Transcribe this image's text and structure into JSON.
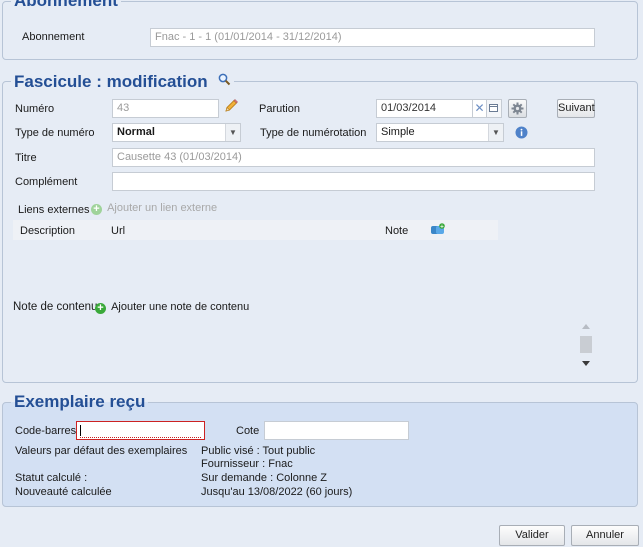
{
  "abonnement": {
    "legend": "Abonnement",
    "label": "Abonnement",
    "value": "Fnac - 1 - 1 (01/01/2014 - 31/12/2014)"
  },
  "fascicule": {
    "legend": "Fascicule : modification",
    "numero_label": "Numéro",
    "numero_value": "43",
    "parution_label": "Parution",
    "parution_value": "01/03/2014",
    "suivant_label": "Suivant",
    "type_numero_label": "Type de numéro",
    "type_numero_value": "Normal",
    "type_numerotation_label": "Type de numérotation",
    "type_numerotation_value": "Simple",
    "titre_label": "Titre",
    "titre_value": "Causette 43 (01/03/2014)",
    "complement_label": "Complément",
    "complement_value": "",
    "liens_label": "Liens externes",
    "add_lien_label": "Ajouter un lien externe",
    "table_headers": {
      "description": "Description",
      "url": "Url",
      "note": "Note"
    },
    "note_contenu_label": "Note de contenu",
    "add_note_label": "Ajouter une note de contenu"
  },
  "exemplaire": {
    "legend": "Exemplaire reçu",
    "code_barres_label": "Code-barres",
    "code_barres_value": "",
    "cote_label": "Cote",
    "cote_value": "",
    "defaults_label": "Valeurs par défaut des exemplaires",
    "public_vise": "Public visé : Tout public",
    "fournisseur": "Fournisseur : Fnac",
    "statut_label": "Statut calculé :",
    "statut_value": "Sur demande : Colonne Z",
    "nouveaute_label": "Nouveauté calculée",
    "nouveaute_value": "Jusqu'au 13/08/2022 (60 jours)"
  },
  "footer": {
    "valider_label": "Valider",
    "annuler_label": "Annuler"
  },
  "colors": {
    "legend": "#244f95",
    "panel_bg": "#e6ecf5",
    "exemplaire_bg": "#d3e0f3",
    "error_border": "#cc2222"
  }
}
